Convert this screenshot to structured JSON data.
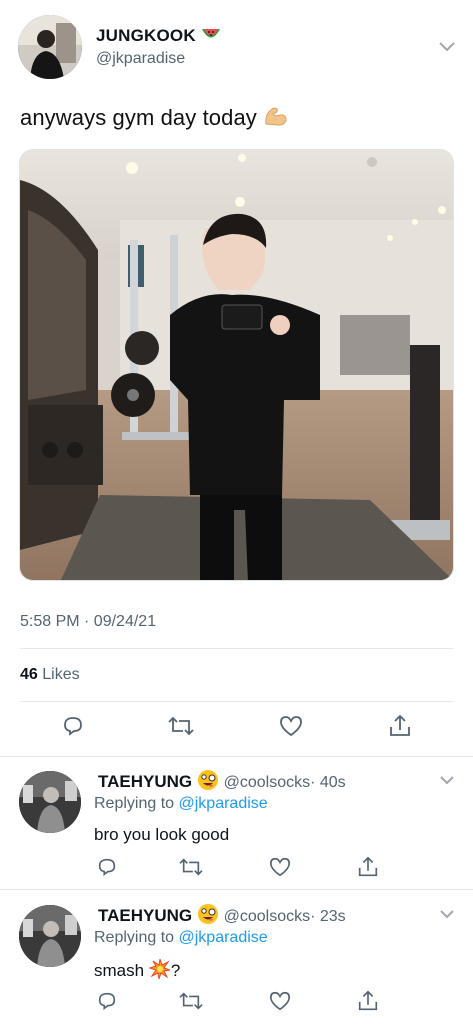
{
  "tweet": {
    "display_name": "JUNGKOOK",
    "name_emoji": "watermelon-icon",
    "handle": "@jkparadise",
    "text": "anyways gym day today",
    "text_emoji": "flexed-biceps-icon",
    "timestamp": "5:58 PM · 09/24/21",
    "likes_count": "46",
    "likes_label": "Likes"
  },
  "actions": [
    "reply-icon",
    "retweet-icon",
    "like-icon",
    "share-icon"
  ],
  "replies": [
    {
      "display_name": "TAEHYUNG",
      "name_emoji": "zany-face-icon",
      "handle": "@coolsocks",
      "time": "· 40s",
      "replying_prefix": "Replying to",
      "replying_handle": "@jkparadise",
      "text": "bro you look good"
    },
    {
      "display_name": "TAEHYUNG",
      "name_emoji": "zany-face-icon",
      "handle": "@coolsocks",
      "time": "· 23s",
      "replying_prefix": "Replying to",
      "replying_handle": "@jkparadise",
      "text_before": "smash",
      "text_emoji": "collision-icon",
      "text_after": "?"
    }
  ],
  "colors": {
    "link": "#1d9bf0",
    "muted": "#536471",
    "text": "#0f1419",
    "divider": "#e6e9eb"
  }
}
